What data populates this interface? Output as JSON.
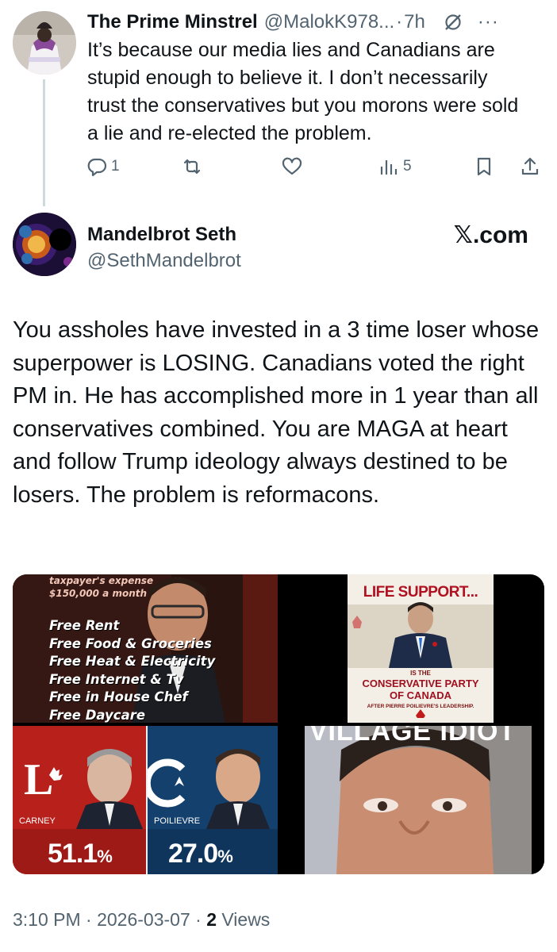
{
  "reply": {
    "author_name": "The Prime Minstrel",
    "author_handle": "@MalokK978...",
    "separator": "·",
    "time": "7h",
    "text": "It’s because our media lies and Canadians are stupid enough to believe it. I don’t necessarily trust the conservatives but you morons were sold a lie and re-elected the problem.",
    "replies_count": "1",
    "views_count": "5",
    "more_glyph": "···"
  },
  "post": {
    "author_name": "Mandelbrot Seth",
    "author_handle": "@SethMandelbrot",
    "site_mark": "𝕏.com",
    "text": "You assholes have invested in a 3 time loser whose superpower is LOSING. Canadians voted the right PM in. He has accomplished more in 1 year than all conservatives combined. You are MAGA at heart and follow Trump ideology always destined to be losers. The problem is reformacons.",
    "timestamp": "3:10 PM · 2026-03-07 · ",
    "views_number": "2",
    "views_label": " Views"
  },
  "media": {
    "tile1": {
      "top_line1": "taxpayer's expense",
      "top_line2": "$150,000 a month",
      "items": [
        "Free Rent",
        "Free Food & Groceries",
        "Free Heat & Electricity",
        "Free Internet & Tv",
        "Free in House Chef",
        "Free Daycare"
      ]
    },
    "tile2": {
      "title": "LIFE SUPPORT...",
      "is_the": "IS THE",
      "party_line1": "CONSERVATIVE PARTY",
      "party_line2": "OF CANADA",
      "after": "AFTER PIERRE POILIEVRE'S LEADERSHIP."
    },
    "tile3": {
      "left_name": "CARNEY",
      "left_pct": "51.1",
      "right_name": "POILIEVRE",
      "right_pct": "27.0",
      "pct_sign": "%"
    },
    "tile4": {
      "caption": "VILLAGE IDIOT"
    }
  },
  "colors": {
    "text_primary": "#0f1419",
    "text_secondary": "#536471",
    "liberal_red": "#b8201c",
    "conservative_blue": "#14406e"
  },
  "icons": [
    "reply-icon",
    "retweet-icon",
    "like-icon",
    "views-icon",
    "bookmark-icon",
    "share-icon",
    "grok-icon",
    "more-icon"
  ]
}
